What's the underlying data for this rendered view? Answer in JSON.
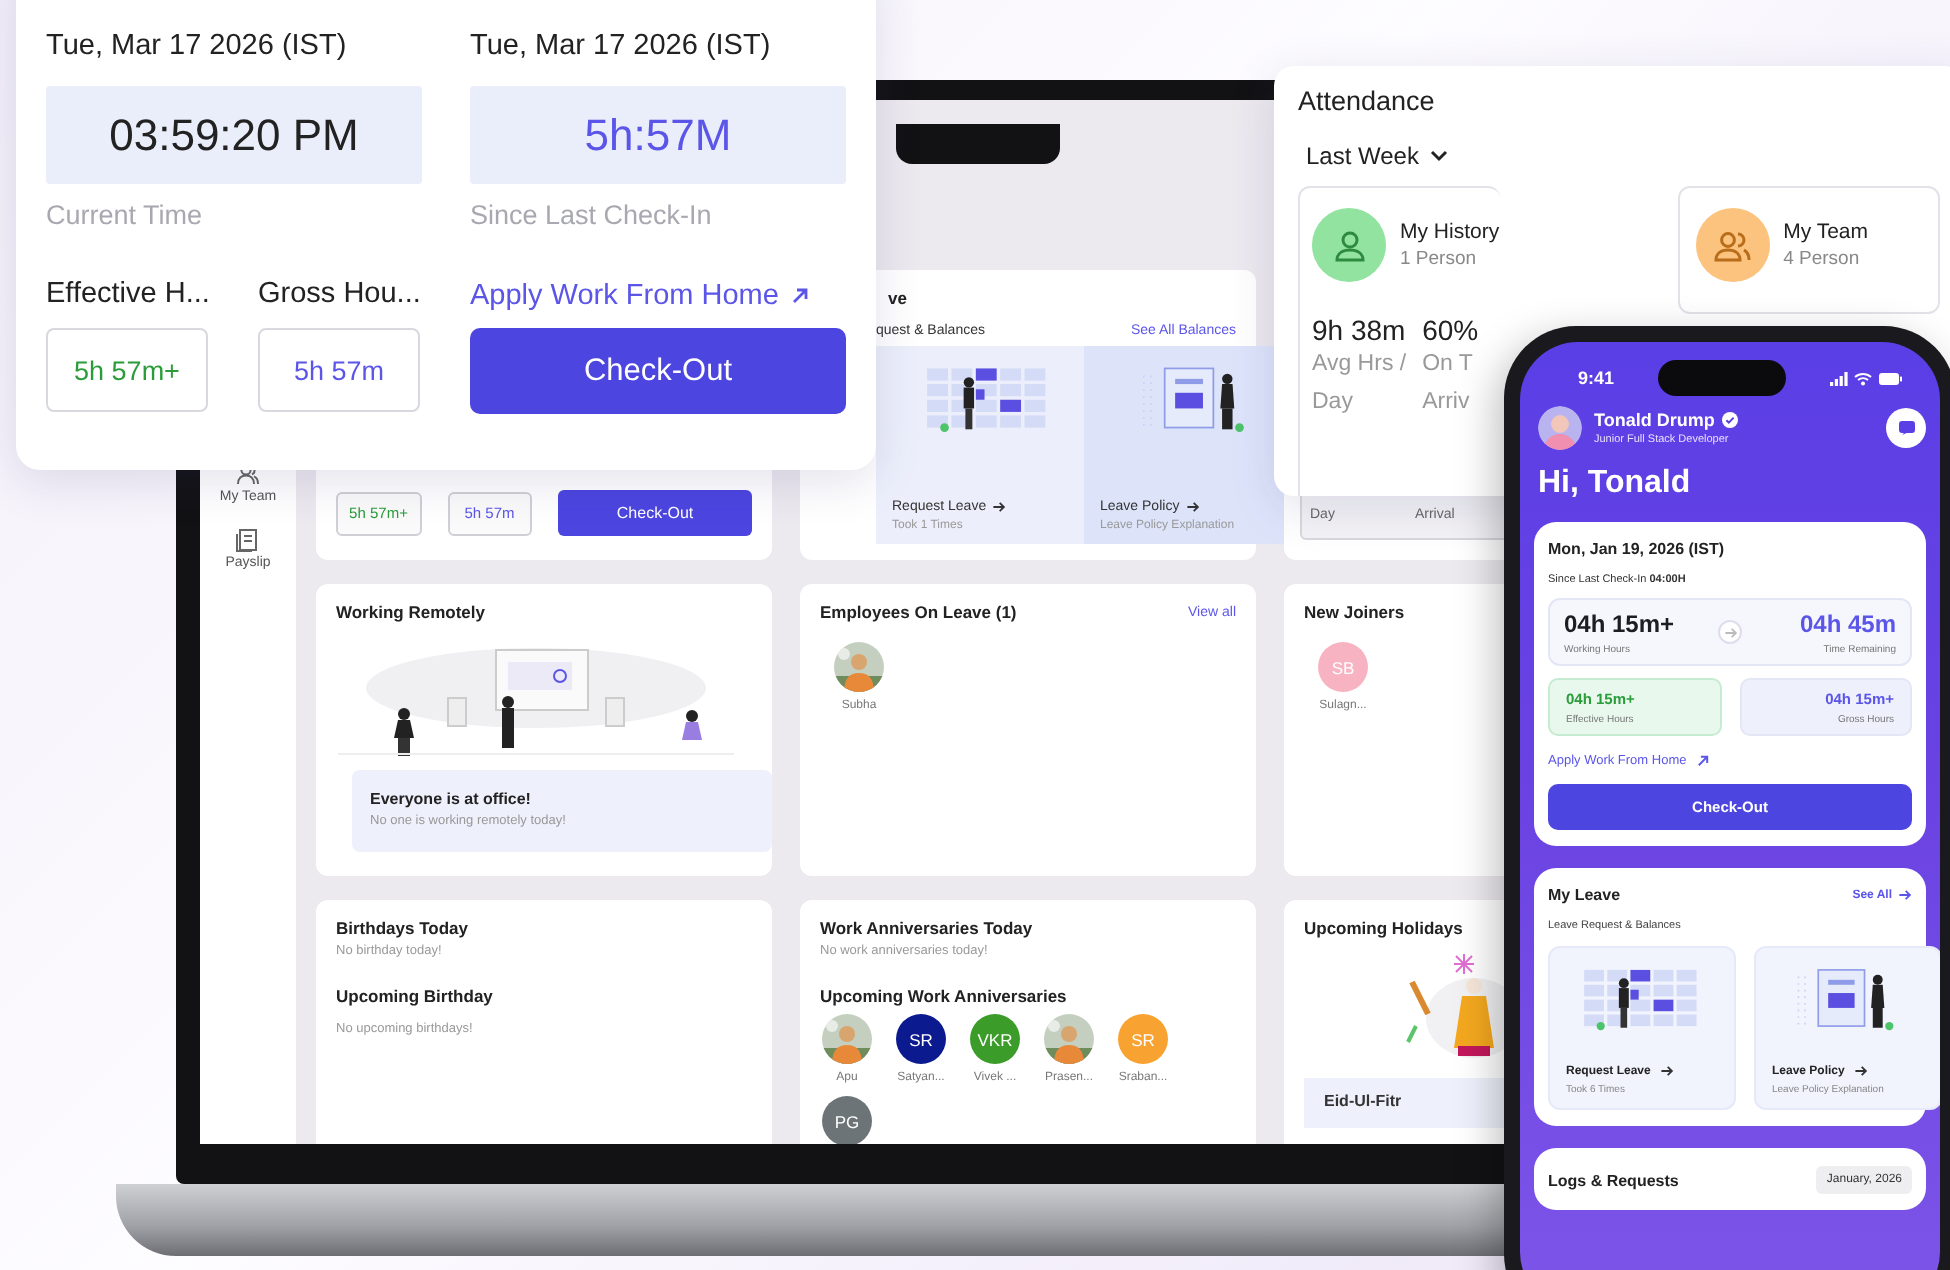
{
  "laptop": {
    "sidebar": [
      {
        "kind": "team",
        "label": "My Team"
      },
      {
        "kind": "payslip",
        "label": "Payslip"
      }
    ],
    "checkin_card": {
      "effective": "5h 57m+",
      "gross": "5h 57m",
      "button": "Check-Out"
    },
    "leave_card": {
      "title": "ve",
      "subtitle": "quest & Balances",
      "link": "See All Balances",
      "tiles": [
        {
          "kind": "request",
          "title": "Request Leave",
          "note": "Took 1 Times"
        },
        {
          "kind": "policy",
          "title": "Leave Policy",
          "note": "Leave Policy Explanation"
        }
      ]
    },
    "attendance_strip": [
      "Day",
      "Arrival"
    ],
    "remote_card": {
      "title": "Working Remotely",
      "message": "Everyone is at office!",
      "note": "No one is working remotely today!"
    },
    "on_leave_card": {
      "title": "Employees On Leave (1)",
      "link": "View all",
      "people": [
        {
          "name": "Subha"
        }
      ]
    },
    "joiners_card": {
      "title": "New Joiners",
      "people": [
        {
          "kind": "initials",
          "initials": "SB",
          "name": "Sulagn...",
          "color": "#f7b3c2"
        }
      ]
    },
    "birthdays_card": {
      "title": "Birthdays Today",
      "note": "No birthday today!",
      "upcoming_title": "Upcoming Birthday",
      "upcoming_note": "No upcoming birthdays!"
    },
    "anniversaries_card": {
      "title": "Work Anniversaries Today",
      "note": "No work anniversaries today!",
      "upcoming_title": "Upcoming Work Anniversaries",
      "people": [
        {
          "name": "Apu"
        },
        {
          "kind": "initials",
          "initials": "SR",
          "name": "Satyan...",
          "color": "#0b1a8f"
        },
        {
          "kind": "initials",
          "initials": "VKR",
          "name": "Vivek ...",
          "color": "#3b9c2a"
        },
        {
          "name": "Prasen..."
        },
        {
          "kind": "initials",
          "initials": "SR",
          "name": "Sraban...",
          "color": "#f8a231"
        },
        {
          "kind": "initials",
          "initials": "PG",
          "color": "#6c7478"
        }
      ]
    },
    "holidays_card": {
      "title": "Upcoming Holidays",
      "holiday": "Eid-Ul-Fitr"
    }
  },
  "time_card": {
    "current": {
      "date": "Tue, Mar 17 2026 (IST)",
      "value": "03:59:20 PM",
      "label": "Current Time"
    },
    "since": {
      "date": "Tue, Mar 17 2026 (IST)",
      "value": "5h:57M",
      "label": "Since Last Check-In"
    },
    "effective": {
      "label": "Effective H...",
      "value": "5h 57m+"
    },
    "gross": {
      "label": "Gross Hou...",
      "value": "5h 57m"
    },
    "wfh_link": "Apply Work From Home",
    "button": "Check-Out"
  },
  "attendance": {
    "title": "Attendance",
    "period": "Last Week",
    "groups": [
      {
        "kind": "history",
        "title": "My History",
        "count": "1 Person",
        "color": "#92e3a0"
      },
      {
        "kind": "team",
        "title": "My Team",
        "count": "4 Person",
        "color": "#fbc37e"
      }
    ],
    "stats": [
      {
        "value": "9h 38m",
        "label_lines": [
          "Avg Hrs /",
          "Day"
        ]
      },
      {
        "value": "60%",
        "label_lines": [
          "On T",
          "Arriv"
        ]
      }
    ]
  },
  "phone": {
    "status_time": "9:41",
    "user": {
      "name": "Tonald Drump",
      "role": "Junior Full Stack Developer",
      "verified": true
    },
    "greeting": "Hi, Tonald",
    "checkin": {
      "date": "Mon, Jan 19, 2026 (IST)",
      "since": "Since Last Check-In **04:00H**",
      "working": {
        "value": "04h 15m+",
        "label": "Working Hours"
      },
      "remaining": {
        "value": "04h 45m",
        "label": "Time Remaining"
      },
      "effective": {
        "value": "04h 15m+",
        "label": "Effective Hours"
      },
      "gross": {
        "value": "04h 15m+",
        "label": "Gross Hours"
      },
      "wfh_link": "Apply Work From Home",
      "button": "Check-Out"
    },
    "leave": {
      "title": "My Leave",
      "link": "See All",
      "subtitle": "Leave Request & Balances",
      "tiles": [
        {
          "kind": "request",
          "title": "Request Leave",
          "note": "Took 6 Times"
        },
        {
          "kind": "policy",
          "title": "Leave Policy",
          "note": "Leave Policy Explanation"
        }
      ]
    },
    "logs": {
      "title": "Logs & Requests",
      "month": "January, 2026"
    }
  }
}
